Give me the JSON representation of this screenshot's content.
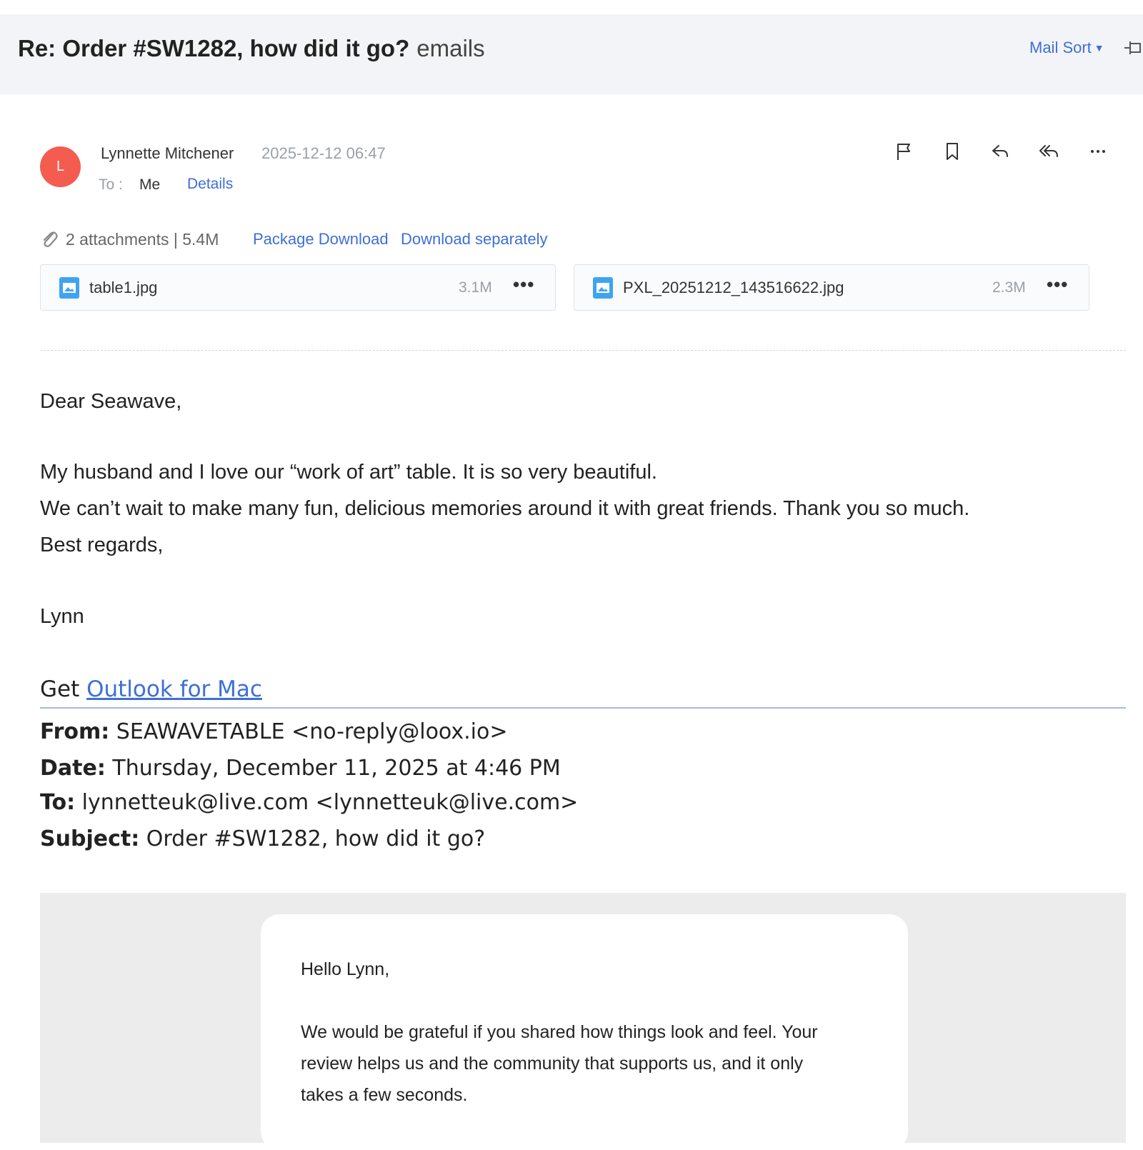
{
  "header": {
    "subject_bold": "Re: Order #SW1282, how did it go?",
    "subject_suffix": "emails",
    "mail_sort_label": "Mail Sort"
  },
  "message": {
    "avatar_letter": "L",
    "sender_name": "Lynnette Mitchener",
    "date": "2025-12-12 06:47",
    "to_label": "To :",
    "to_value": "Me",
    "details_label": "Details",
    "toolbar_icons": [
      "flag-icon",
      "bookmark-icon",
      "reply-icon",
      "reply-all-icon",
      "more-icon"
    ],
    "accent_color": "#3d6fd8",
    "avatar_color": "#f45c50"
  },
  "attachments": {
    "summary": "2 attachments | 5.4M",
    "package_download": "Package Download",
    "download_separately": "Download separately",
    "files": [
      {
        "name": "table1.jpg",
        "size": "3.1M",
        "more": "•••"
      },
      {
        "name": "PXL_20251212_143516622.jpg",
        "size": "2.3M",
        "more": "•••"
      }
    ]
  },
  "body": {
    "greeting": "Dear Seawave,",
    "line1": "My husband and I love our “work of art” table. It is so very beautiful.",
    "line2": "We can’t wait to make many fun, delicious memories around it with great friends. Thank you so much.",
    "line3": "Best regards,",
    "signature": "Lynn",
    "get_prefix": "Get",
    "outlook_link": "Outlook for Mac"
  },
  "quoted": {
    "from_label": "From:",
    "from_value": "SEAWAVETABLE <no-reply@loox.io>",
    "date_label": "Date:",
    "date_value": "Thursday, December 11, 2025 at 4:46 PM",
    "to_label": "To:",
    "to_value": "lynnetteuk@live.com <lynnetteuk@live.com>",
    "subject_label": "Subject:",
    "subject_value": "Order #SW1282, how did it go?"
  },
  "embedded_card": {
    "greeting": "Hello Lynn,",
    "line1": "We would be grateful if you shared how things look and feel. Your",
    "line2": "review helps us and the community that supports us, and it only",
    "line3": "takes a few seconds."
  }
}
